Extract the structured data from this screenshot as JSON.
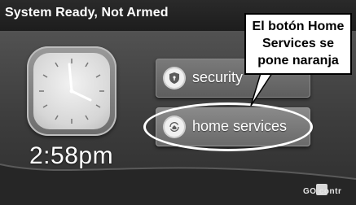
{
  "status_bar": {
    "text": "System Ready, Not Armed"
  },
  "clock": {
    "time": "2:58pm",
    "icon": "analog-clock-icon"
  },
  "menu": {
    "security": {
      "label": "security",
      "icon": "shield-icon"
    },
    "home_services": {
      "label": "home services",
      "icon": "home-arrows-icon"
    }
  },
  "annotation": {
    "callout_text": "El botón Home Services se pone naranja"
  },
  "brand": {
    "logo_text": "GO  contr"
  },
  "colors": {
    "background": "#3c3c3c",
    "status_bar": "#1d1d1d",
    "button": "#6a6a6a",
    "highlight": "#ffffff"
  }
}
